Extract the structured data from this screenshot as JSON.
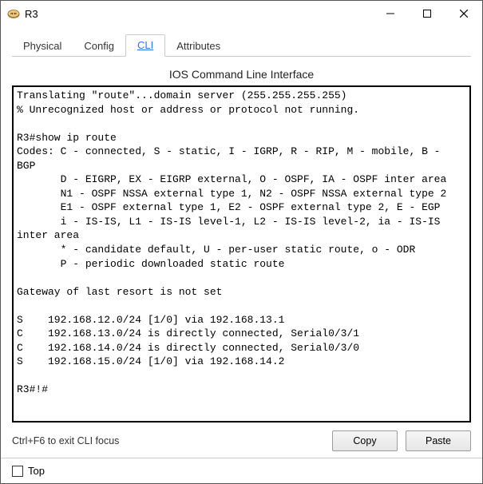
{
  "window": {
    "title": "R3"
  },
  "tabs": {
    "physical": "Physical",
    "config": "Config",
    "cli": "CLI",
    "attributes": "Attributes"
  },
  "cli": {
    "heading": "IOS Command Line Interface",
    "output": "Translating \"route\"...domain server (255.255.255.255)\n% Unrecognized host or address or protocol not running.\n\nR3#show ip route\nCodes: C - connected, S - static, I - IGRP, R - RIP, M - mobile, B - BGP\n       D - EIGRP, EX - EIGRP external, O - OSPF, IA - OSPF inter area\n       N1 - OSPF NSSA external type 1, N2 - OSPF NSSA external type 2\n       E1 - OSPF external type 1, E2 - OSPF external type 2, E - EGP\n       i - IS-IS, L1 - IS-IS level-1, L2 - IS-IS level-2, ia - IS-IS inter area\n       * - candidate default, U - per-user static route, o - ODR\n       P - periodic downloaded static route\n\nGateway of last resort is not set\n\nS    192.168.12.0/24 [1/0] via 192.168.13.1\nC    192.168.13.0/24 is directly connected, Serial0/3/1\nC    192.168.14.0/24 is directly connected, Serial0/3/0\nS    192.168.15.0/24 [1/0] via 192.168.14.2\n\nR3#!#"
  },
  "footer": {
    "hint": "Ctrl+F6 to exit CLI focus",
    "copy": "Copy",
    "paste": "Paste",
    "top_label": "Top"
  }
}
